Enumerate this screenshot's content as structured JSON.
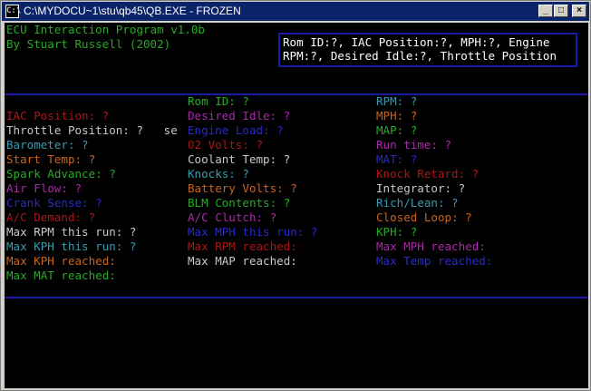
{
  "window": {
    "title": "C:\\MYDOCU~1\\stu\\qb45\\QB.EXE - FROZEN",
    "icon_label": "C:\\",
    "controls": {
      "minimize": "_",
      "maximize": "□",
      "close": "×"
    }
  },
  "header": {
    "line1": "ECU Interaction Program v1.0b",
    "line2": "By Stuart Russell (2002)"
  },
  "idbox": {
    "line1": "Rom ID:?, IAC Position:?, MPH:?, Engine",
    "line2": "RPM:?, Desired Idle:?, Throttle Position"
  },
  "col1": [
    {
      "text": "IAC Position: ?",
      "color": "#a81818"
    },
    {
      "text": "Throttle Position: ?   se",
      "color": "#c8c8c8"
    },
    {
      "text": "Barometer: ?",
      "color": "#3a9ab0"
    },
    {
      "text": "Start Temp: ?",
      "color": "#c86420"
    },
    {
      "text": "Spark Advance: ?",
      "color": "#2aa82a"
    },
    {
      "text": "Air Flow: ?",
      "color": "#a82aa8"
    },
    {
      "text": "Crank Sense: ?",
      "color": "#2a2ac8"
    },
    {
      "text": "A/C Demand: ?",
      "color": "#a81818"
    },
    {
      "text": "Max RPM this run: ?",
      "color": "#c8c8c8"
    },
    {
      "text": "Max KPH this run: ?",
      "color": "#3a9ab0"
    },
    {
      "text": "Max KPH reached:",
      "color": "#c86420"
    },
    {
      "text": "Max MAT reached:",
      "color": "#2aa82a"
    }
  ],
  "col2": [
    {
      "text": "Rom ID: ?",
      "color": "#2aa82a"
    },
    {
      "text": "Desired Idle: ?",
      "color": "#a82aa8"
    },
    {
      "text": "Engine Load: ?",
      "color": "#2a2ac8"
    },
    {
      "text": "O2 Volts: ?",
      "color": "#a81818"
    },
    {
      "text": "Coolant Temp: ?",
      "color": "#c8c8c8"
    },
    {
      "text": "Knocks: ?",
      "color": "#3a9ab0"
    },
    {
      "text": "Battery Volts: ?",
      "color": "#c86420"
    },
    {
      "text": "BLM Contents: ?",
      "color": "#2aa82a"
    },
    {
      "text": "A/C Clutch: ?",
      "color": "#a82aa8"
    },
    {
      "text": "Max MPH this run: ?",
      "color": "#2a2ac8"
    },
    {
      "text": "Max RPM reached:",
      "color": "#a81818"
    },
    {
      "text": "Max MAP reached:",
      "color": "#c8c8c8"
    }
  ],
  "col3": [
    {
      "text": "RPM: ?",
      "color": "#3a9ab0"
    },
    {
      "text": "MPH: ?",
      "color": "#c86420"
    },
    {
      "text": "MAP: ?",
      "color": "#2aa82a"
    },
    {
      "text": "Run time: ?",
      "color": "#a82aa8"
    },
    {
      "text": "MAT: ?",
      "color": "#2a2ac8"
    },
    {
      "text": "Knock Retard: ?",
      "color": "#a81818"
    },
    {
      "text": "Integrator: ?",
      "color": "#c8c8c8"
    },
    {
      "text": "Rich/Lean: ?",
      "color": "#3a9ab0"
    },
    {
      "text": "Closed Loop: ?",
      "color": "#c86420"
    },
    {
      "text": "KPH: ?",
      "color": "#2aa82a"
    },
    {
      "text": "Max MPH reached:",
      "color": "#a82aa8"
    },
    {
      "text": "Max Temp reached:",
      "color": "#2a2ac8"
    }
  ],
  "colors": {
    "header_text": "#2aa82a",
    "idbox_text": "#ffffff",
    "rule": "#1a1aa8",
    "titlebar": "#0a246a"
  }
}
